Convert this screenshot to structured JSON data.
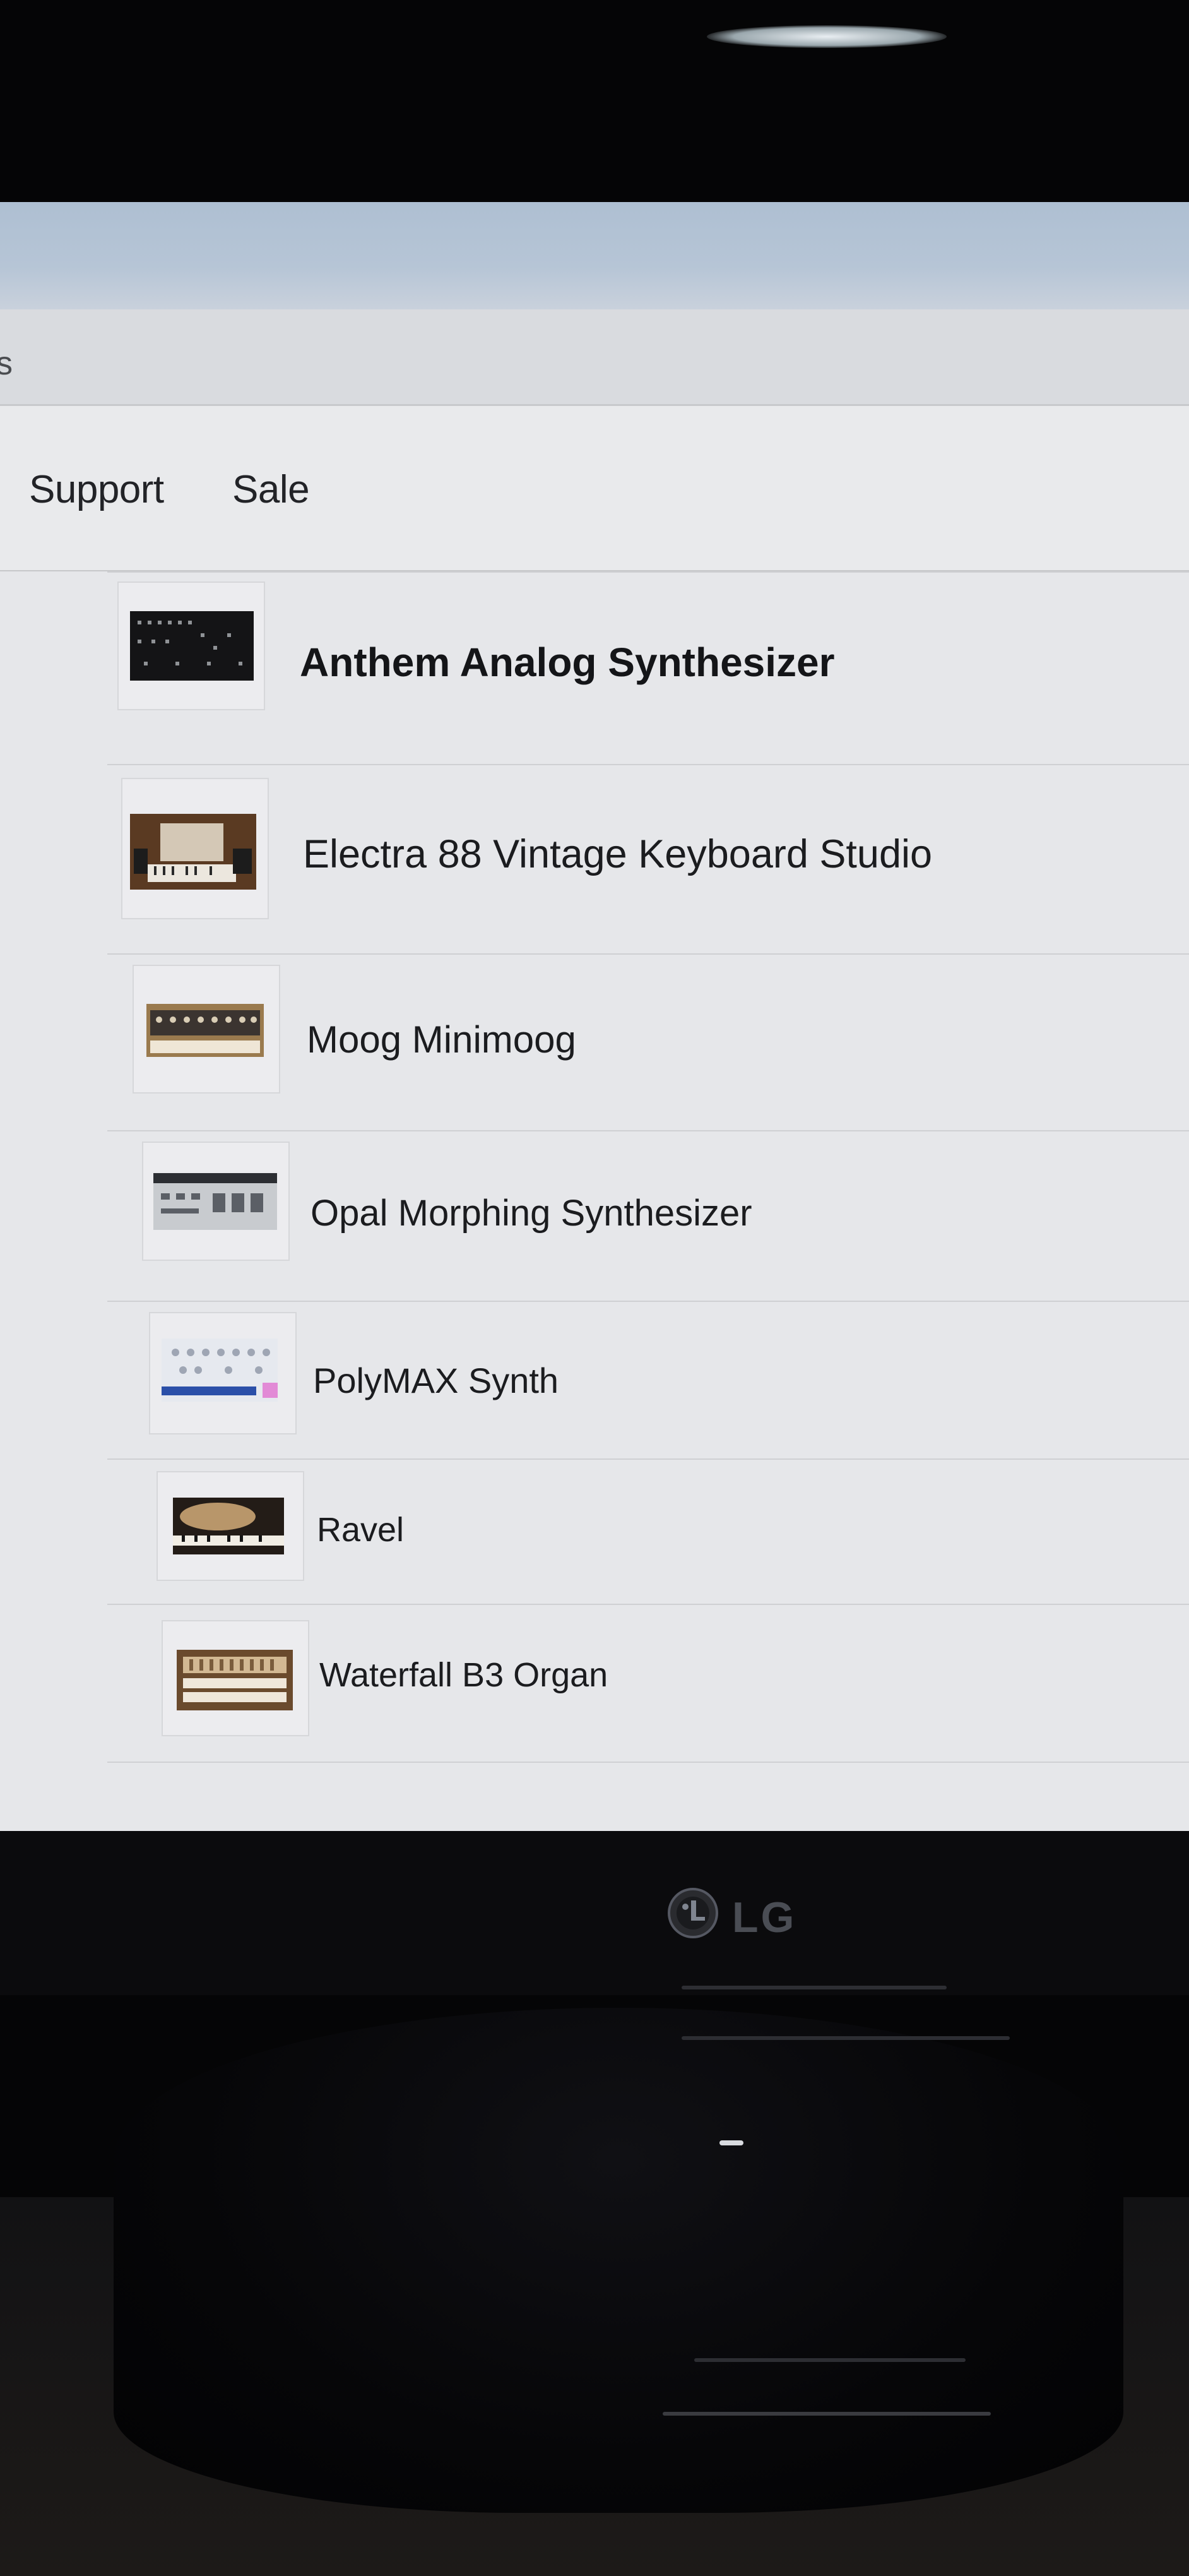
{
  "nav": {
    "edge_glyph": "s",
    "items": [
      {
        "label": "Support"
      },
      {
        "label": "Sale"
      }
    ]
  },
  "products": [
    {
      "name": "Anthem Analog Synthesizer",
      "thumb_icon": "synth-panel-thumbnail"
    },
    {
      "name": "Electra 88 Vintage Keyboard Studio",
      "thumb_icon": "keyboard-studio-thumbnail"
    },
    {
      "name": "Moog Minimoog",
      "thumb_icon": "minimoog-thumbnail"
    },
    {
      "name": "Opal Morphing Synthesizer",
      "thumb_icon": "opal-synth-thumbnail"
    },
    {
      "name": "PolyMAX Synth",
      "thumb_icon": "polymax-thumbnail"
    },
    {
      "name": "Ravel",
      "thumb_icon": "piano-thumbnail"
    },
    {
      "name": "Waterfall B3 Organ",
      "thumb_icon": "organ-thumbnail"
    }
  ],
  "monitor": {
    "brand": "LG"
  }
}
